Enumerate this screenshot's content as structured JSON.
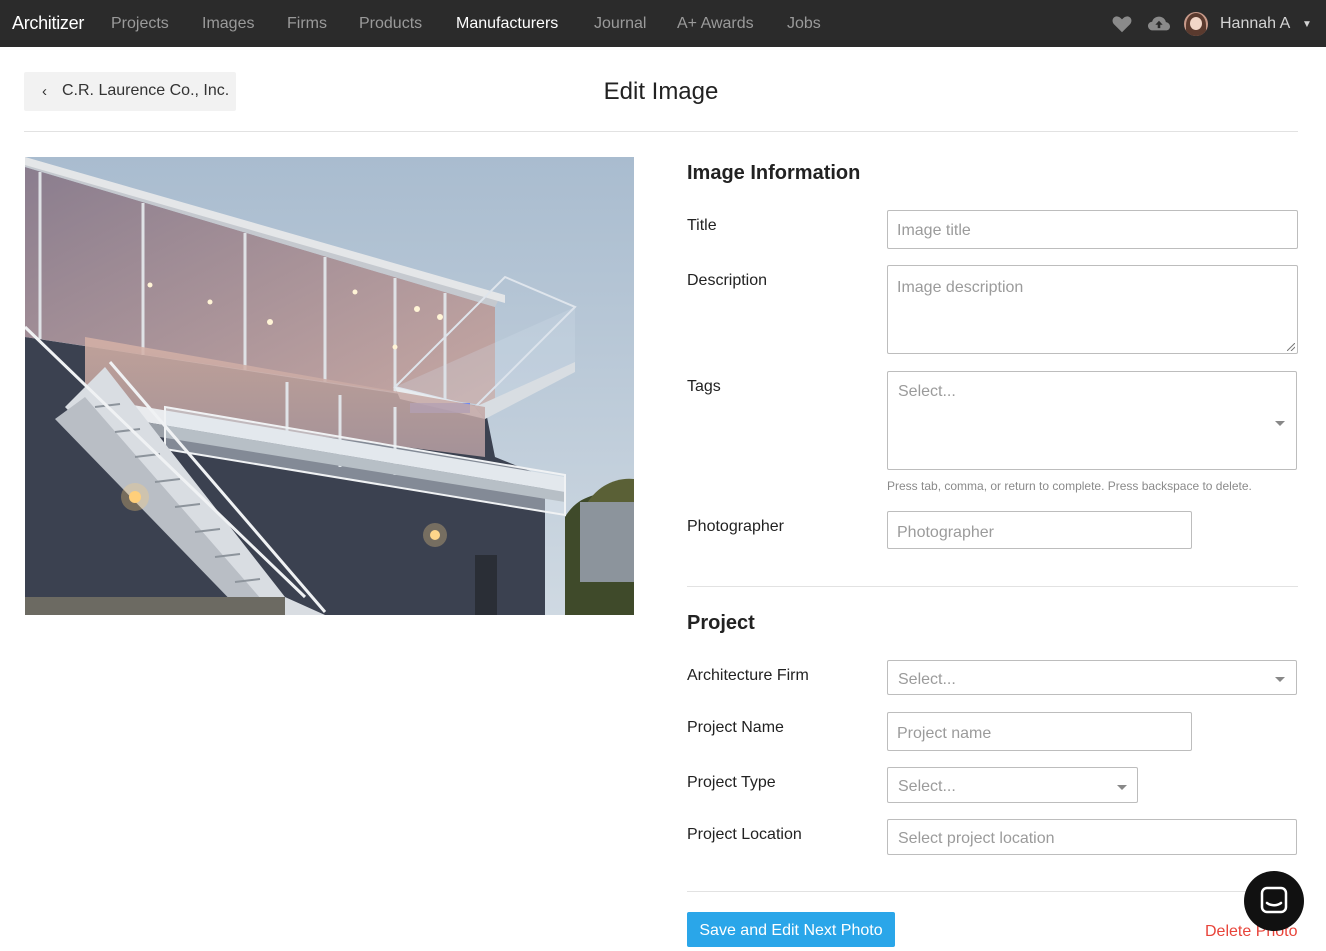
{
  "nav": {
    "logo": "Architizer",
    "items": [
      {
        "label": "Projects",
        "active": false
      },
      {
        "label": "Images",
        "active": false
      },
      {
        "label": "Firms",
        "active": false
      },
      {
        "label": "Products",
        "active": false
      },
      {
        "label": "Manufacturers",
        "active": true
      },
      {
        "label": "Journal",
        "active": false
      },
      {
        "label": "A+ Awards",
        "active": false
      },
      {
        "label": "Jobs",
        "active": false
      }
    ],
    "icons": [
      "heart-icon",
      "upload-cloud-icon"
    ],
    "user_name": "Hannah A"
  },
  "header": {
    "back_label": "C.R. Laurence Co., Inc.",
    "title": "Edit Image"
  },
  "image_info": {
    "section_title": "Image Information",
    "title_label": "Title",
    "title_placeholder": "Image title",
    "description_label": "Description",
    "description_placeholder": "Image description",
    "tags_label": "Tags",
    "tags_placeholder": "Select...",
    "tags_hint": "Press tab, comma, or return to complete. Press backspace to delete.",
    "photographer_label": "Photographer",
    "photographer_placeholder": "Photographer"
  },
  "project": {
    "section_title": "Project",
    "firm_label": "Architecture Firm",
    "firm_placeholder": "Select...",
    "name_label": "Project Name",
    "name_placeholder": "Project name",
    "type_label": "Project Type",
    "type_placeholder": "Select...",
    "location_label": "Project Location",
    "location_placeholder": "Select project location"
  },
  "actions": {
    "save_label": "Save and Edit Next Photo",
    "delete_label": "Delete Photo"
  },
  "colors": {
    "nav_bg": "#2b2b2b",
    "primary": "#2aa6e9",
    "danger": "#e8443a"
  }
}
